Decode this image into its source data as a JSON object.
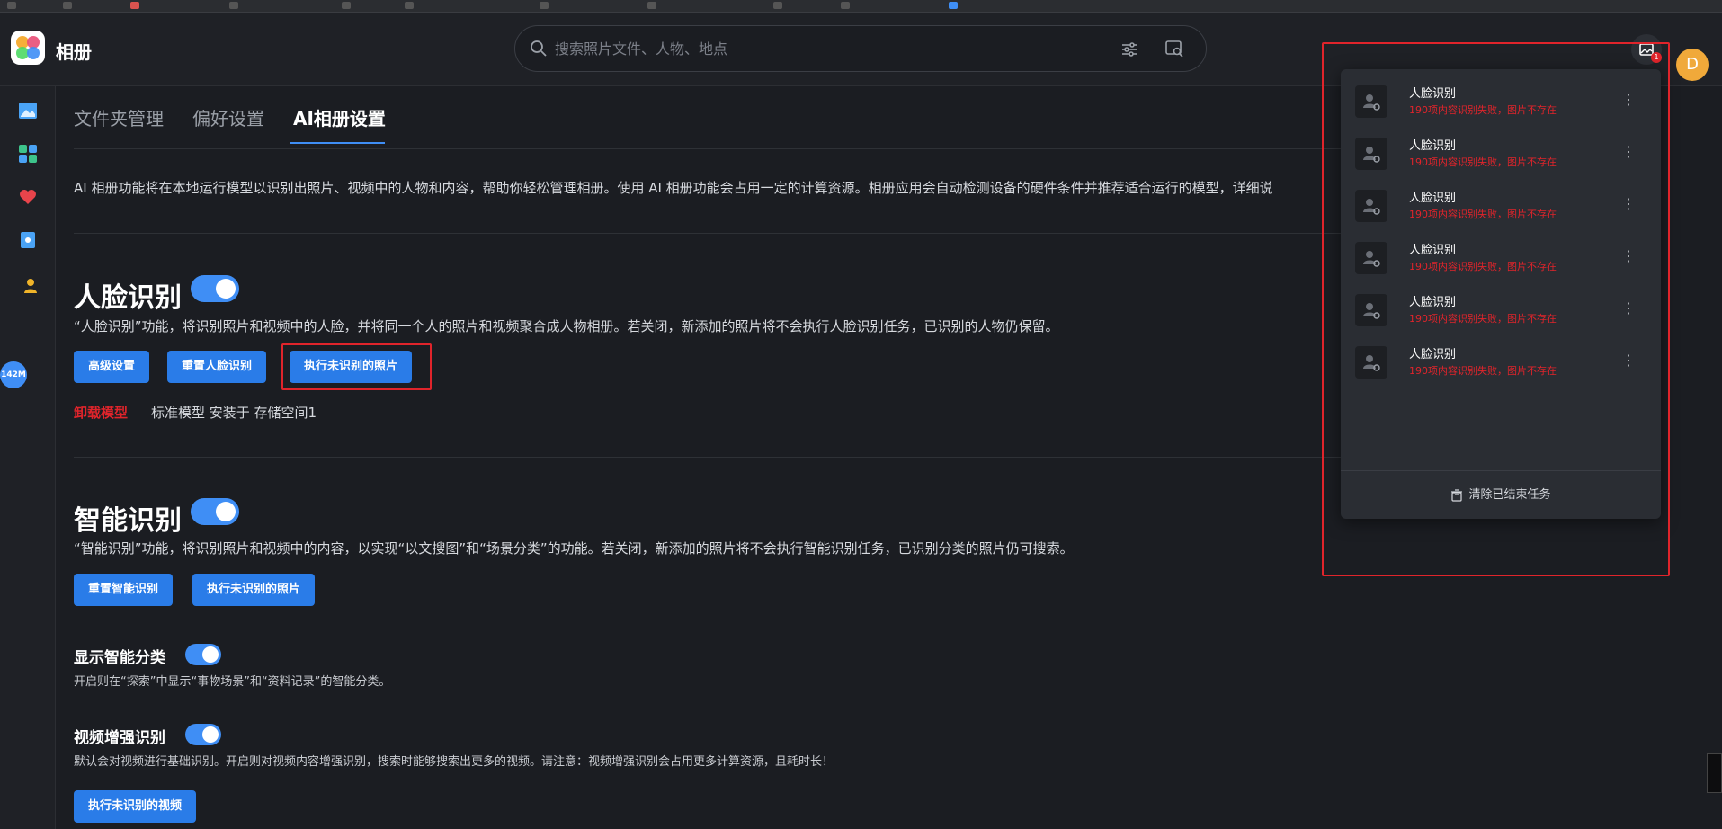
{
  "app": {
    "title": "相册"
  },
  "search": {
    "placeholder": "搜索照片文件、人物、地点"
  },
  "header": {
    "task_badge": "1",
    "avatar_letter": "D"
  },
  "rail": {
    "storage_label": "142M"
  },
  "tabs": [
    {
      "label": "文件夹管理",
      "active": false
    },
    {
      "label": "偏好设置",
      "active": false
    },
    {
      "label": "AI相册设置",
      "active": true
    }
  ],
  "intro": "AI 相册功能将在本地运行模型以识别出照片、视频中的人物和内容，帮助你轻松管理相册。使用 AI 相册功能会占用一定的计算资源。相册应用会自动检测设备的硬件条件并推荐适合运行的模型，详细说",
  "face": {
    "title": "人脸识别",
    "enabled": true,
    "desc": "“人脸识别”功能，将识别照片和视频中的人脸，并将同一个人的照片和视频聚合成人物相册。若关闭，新添加的照片将不会执行人脸识别任务，已识别的人物仍保留。",
    "btn_advanced": "高级设置",
    "btn_reset": "重置人脸识别",
    "btn_run": "执行未识别的照片",
    "uninstall": "卸载模型",
    "model_info": "标准模型 安装于 存储空间1"
  },
  "smart": {
    "title": "智能识别",
    "enabled": true,
    "desc": "“智能识别”功能，将识别照片和视频中的内容，以实现“以文搜图”和“场景分类”的功能。若关闭，新添加的照片将不会执行智能识别任务，已识别分类的照片仍可搜索。",
    "btn_reset": "重置智能识别",
    "btn_run": "执行未识别的照片"
  },
  "show_category": {
    "title": "显示智能分类",
    "enabled": true,
    "desc": "开启则在“探索”中显示“事物场景”和“资料记录”的智能分类。"
  },
  "video": {
    "title": "视频增强识别",
    "enabled": true,
    "desc": "默认会对视频进行基础识别。开启则对视频内容增强识别，搜索时能够搜索出更多的视频。请注意：视频增强识别会占用更多计算资源，且耗时长！",
    "btn_run": "执行未识别的视频"
  },
  "tasks": {
    "items": [
      {
        "name": "人脸识别",
        "error": "190项内容识别失败，图片不存在"
      },
      {
        "name": "人脸识别",
        "error": "190项内容识别失败，图片不存在"
      },
      {
        "name": "人脸识别",
        "error": "190项内容识别失败，图片不存在"
      },
      {
        "name": "人脸识别",
        "error": "190项内容识别失败，图片不存在"
      },
      {
        "name": "人脸识别",
        "error": "190项内容识别失败，图片不存在"
      },
      {
        "name": "人脸识别",
        "error": "190项内容识别失败，图片不存在"
      }
    ],
    "clear_label": "清除已结束任务"
  },
  "colors": {
    "accent": "#2a7ce8",
    "error": "#e0242b",
    "background": "#1b1d22",
    "avatar": "#f0a93a"
  }
}
